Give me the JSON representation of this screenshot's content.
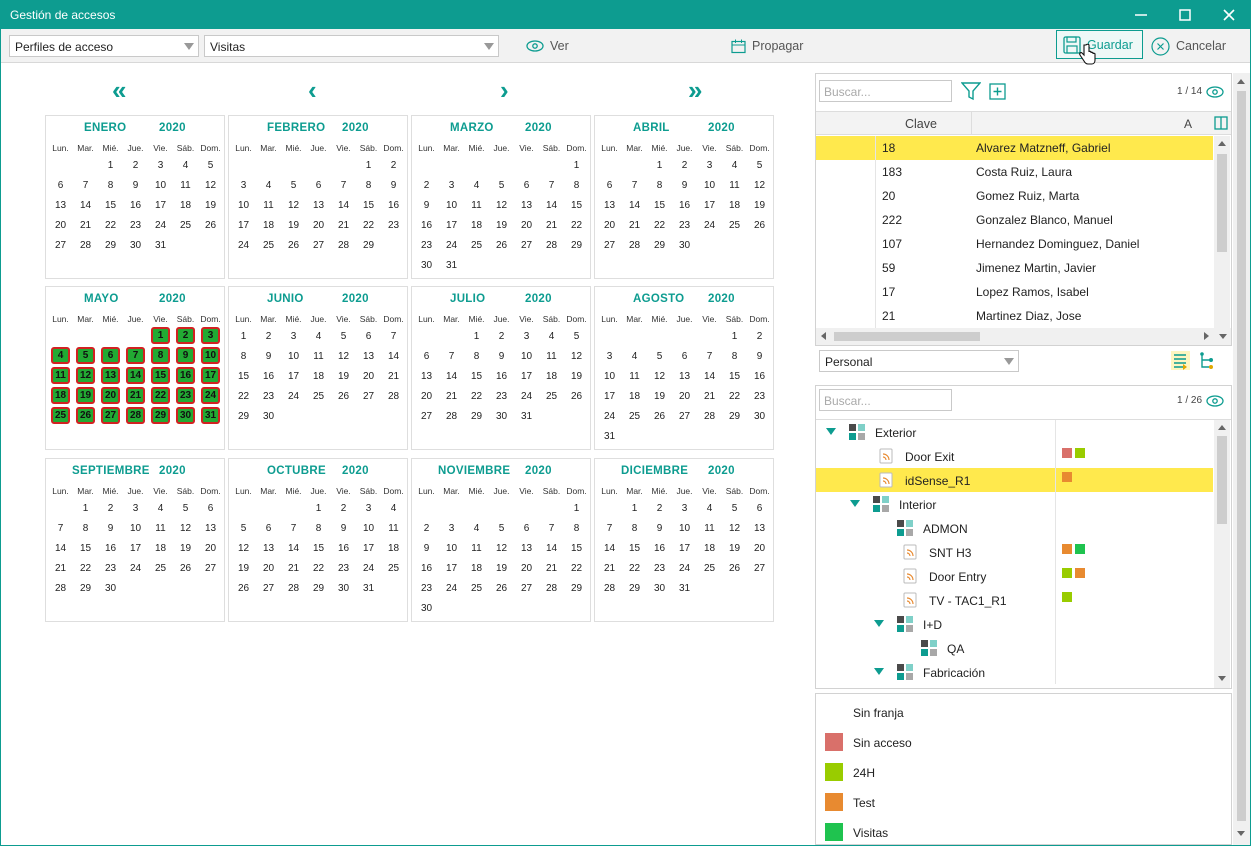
{
  "window": {
    "title": "Gestión de accesos"
  },
  "toolbar": {
    "profile_select": "Perfiles de acceso",
    "mode_select": "Visitas",
    "ver_label": "Ver",
    "propagar_label": "Propagar",
    "guardar_label": "Guardar",
    "cancelar_label": "Cancelar"
  },
  "calendar": {
    "year": "2020",
    "weekdays": [
      "Lun.",
      "Mar.",
      "Mié.",
      "Jue.",
      "Vie.",
      "Sáb.",
      "Dom."
    ],
    "nav": {
      "first": "«",
      "prev": "‹",
      "next": "›",
      "last": "»"
    },
    "months": [
      {
        "name": "ENERO",
        "offset": 2,
        "days": 31,
        "highlight": []
      },
      {
        "name": "FEBRERO",
        "offset": 5,
        "days": 29,
        "highlight": []
      },
      {
        "name": "MARZO",
        "offset": 6,
        "days": 31,
        "highlight": []
      },
      {
        "name": "ABRIL",
        "offset": 2,
        "days": 30,
        "highlight": []
      },
      {
        "name": "MAYO",
        "offset": 4,
        "days": 31,
        "highlight": [
          1,
          2,
          3,
          4,
          5,
          6,
          7,
          8,
          9,
          10,
          11,
          12,
          13,
          14,
          15,
          16,
          17,
          18,
          19,
          20,
          21,
          22,
          23,
          24,
          25,
          26,
          27,
          28,
          29,
          30,
          31
        ]
      },
      {
        "name": "JUNIO",
        "offset": 0,
        "days": 30,
        "highlight": []
      },
      {
        "name": "JULIO",
        "offset": 2,
        "days": 31,
        "highlight": []
      },
      {
        "name": "AGOSTO",
        "offset": 5,
        "days": 31,
        "highlight": []
      },
      {
        "name": "SEPTIEMBRE",
        "offset": 1,
        "days": 30,
        "highlight": []
      },
      {
        "name": "OCTUBRE",
        "offset": 3,
        "days": 31,
        "highlight": []
      },
      {
        "name": "NOVIEMBRE",
        "offset": 6,
        "days": 30,
        "highlight": []
      },
      {
        "name": "DICIEMBRE",
        "offset": 1,
        "days": 31,
        "highlight": []
      }
    ]
  },
  "people": {
    "search_placeholder": "Buscar...",
    "count": "1 / 14",
    "col_clave": "Clave",
    "col_extra": "A",
    "rows": [
      {
        "clave": "18",
        "name": "Alvarez Matzneff, Gabriel",
        "selected": true
      },
      {
        "clave": "183",
        "name": "Costa Ruiz, Laura",
        "selected": false
      },
      {
        "clave": "20",
        "name": "Gomez Ruiz, Marta",
        "selected": false
      },
      {
        "clave": "222",
        "name": "Gonzalez Blanco, Manuel",
        "selected": false
      },
      {
        "clave": "107",
        "name": "Hernandez Dominguez, Daniel",
        "selected": false
      },
      {
        "clave": "59",
        "name": "Jimenez Martin, Javier",
        "selected": false
      },
      {
        "clave": "17",
        "name": "Lopez Ramos, Isabel",
        "selected": false
      },
      {
        "clave": "21",
        "name": "Martinez Diaz, Jose",
        "selected": false
      }
    ]
  },
  "filter_select": "Personal",
  "doors": {
    "search_placeholder": "Buscar...",
    "count": "1 / 26",
    "items": [
      {
        "label": "Exterior",
        "indent": 0,
        "type": "group",
        "expander": true,
        "colors": [],
        "selected": false
      },
      {
        "label": "Door Exit",
        "indent": 1,
        "type": "door",
        "expander": false,
        "colors": [
          "#d9706a",
          "#99cc00"
        ],
        "selected": false
      },
      {
        "label": "idSense_R1",
        "indent": 1,
        "type": "door",
        "expander": false,
        "colors": [
          "#e88a30"
        ],
        "selected": true
      },
      {
        "label": "Interior",
        "indent": 1,
        "type": "group",
        "expander": true,
        "colors": [],
        "selected": false
      },
      {
        "label": "ADMON",
        "indent": 2,
        "type": "group",
        "expander": false,
        "colors": [],
        "selected": false
      },
      {
        "label": "SNT H3",
        "indent": 2,
        "type": "door",
        "expander": false,
        "colors": [
          "#e88a30",
          "#1fc34f"
        ],
        "selected": false
      },
      {
        "label": "Door Entry",
        "indent": 2,
        "type": "door",
        "expander": false,
        "colors": [
          "#99cc00",
          "#e88a30"
        ],
        "selected": false
      },
      {
        "label": "TV - TAC1_R1",
        "indent": 2,
        "type": "door",
        "expander": false,
        "colors": [
          "#99cc00"
        ],
        "selected": false
      },
      {
        "label": "I+D",
        "indent": 2,
        "type": "group",
        "expander": true,
        "colors": [],
        "selected": false
      },
      {
        "label": "QA",
        "indent": 3,
        "type": "group",
        "expander": false,
        "colors": [],
        "selected": false
      },
      {
        "label": "Fabricación",
        "indent": 2,
        "type": "group",
        "expander": true,
        "colors": [],
        "selected": false
      }
    ]
  },
  "legend": [
    {
      "label": "Sin franja",
      "color": ""
    },
    {
      "label": "Sin acceso",
      "color": "#d9706a"
    },
    {
      "label": "24H",
      "color": "#99cc00"
    },
    {
      "label": "Test",
      "color": "#e88a30"
    },
    {
      "label": "Visitas",
      "color": "#1fc34f"
    }
  ],
  "colors": {
    "accent": "#0d9c90",
    "selected_row": "#ffe94d",
    "highlight_day": "#22aa33",
    "highlight_border": "#d22222"
  }
}
